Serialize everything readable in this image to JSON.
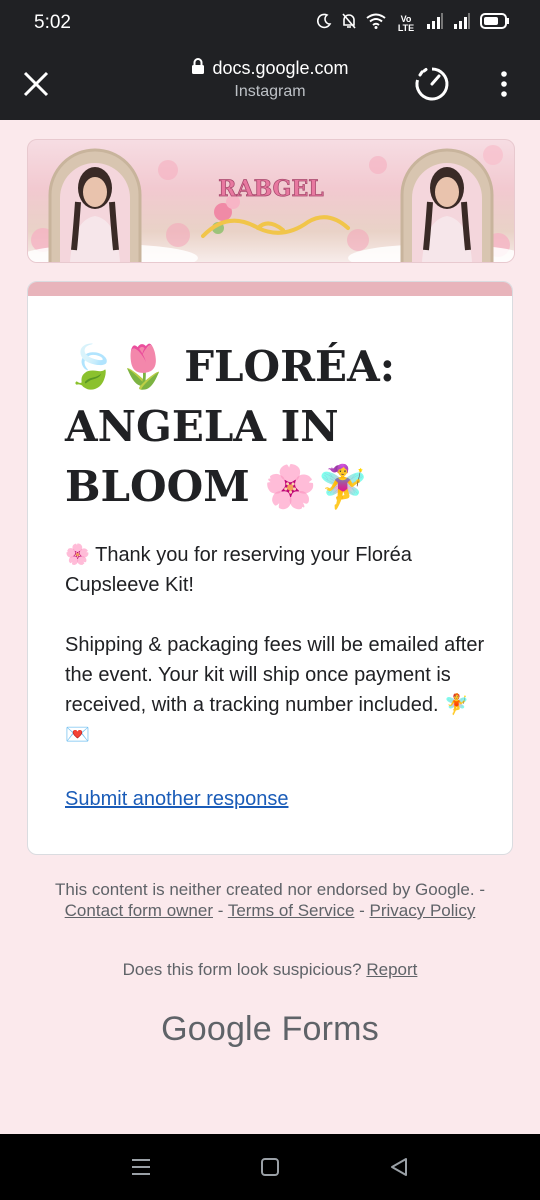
{
  "status_bar": {
    "time": "5:02",
    "network_label": "Vo LTE",
    "icons": [
      "moon-icon",
      "bell-off-icon",
      "wifi-icon",
      "signal-icon",
      "signal-icon",
      "battery-icon"
    ]
  },
  "toolbar": {
    "url": "docs.google.com",
    "subtitle": "Instagram",
    "icons": [
      "close-icon",
      "lock-icon",
      "speed-icon",
      "more-vert-icon"
    ]
  },
  "banner": {
    "logo_text": "RABGEL"
  },
  "form": {
    "title": "🍃🌷 FLORÉA: ANGELA IN BLOOM 🌸🧚‍♀️",
    "message_1": "🌸 Thank you for reserving your Floréa Cupsleeve Kit!",
    "message_2": "Shipping & packaging fees will be emailed after the event. Your kit will ship once payment is received, with a tracking number included. 🧚💌",
    "submit_another": "Submit another response"
  },
  "footer": {
    "disclaimer": "This content is neither created nor endorsed by Google.",
    "contact_owner": "Contact form owner",
    "terms": "Terms of Service",
    "privacy": "Privacy Policy",
    "suspicious_question": "Does this form look suspicious?",
    "report": "Report",
    "logo_brand": "Google",
    "logo_product": "Forms"
  },
  "colors": {
    "page_bg": "#fbe9ec",
    "card_accent": "#e8b4bb",
    "link": "#1a5cb8",
    "chrome_bg": "#202124"
  },
  "nav_bar": {
    "icons": [
      "menu-icon",
      "home-icon",
      "back-icon"
    ]
  }
}
